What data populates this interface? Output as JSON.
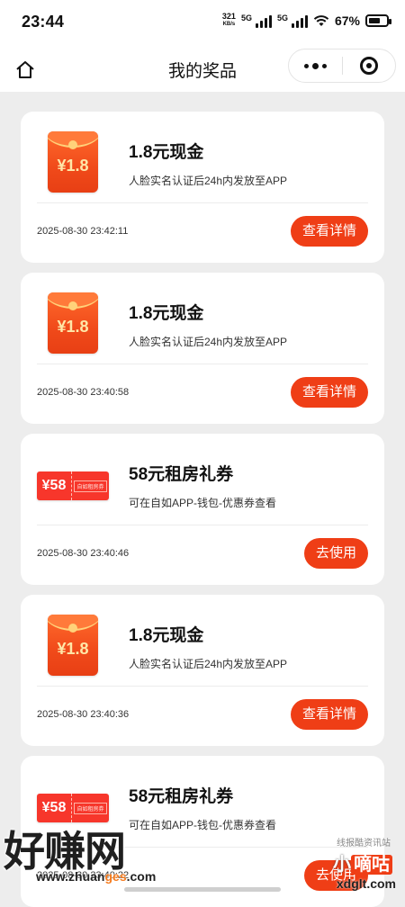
{
  "status_bar": {
    "time": "23:44",
    "net_speed_value": "321",
    "net_speed_unit": "KB/s",
    "sim1_label": "5G",
    "sim2_label": "5G",
    "battery_percent": "67%",
    "battery_level": 0.67
  },
  "nav": {
    "title": "我的奖品",
    "home_icon": "home-icon",
    "more_icon": "more-dots-icon",
    "close_icon": "target-close-icon"
  },
  "prizes": [
    {
      "type": "red-envelope",
      "thumb_amount": "¥1.8",
      "title": "1.8元现金",
      "desc": "人脸实名认证后24h内发放至APP",
      "time": "2025-08-30 23:42:11",
      "action": "查看详情"
    },
    {
      "type": "red-envelope",
      "thumb_amount": "¥1.8",
      "title": "1.8元现金",
      "desc": "人脸实名认证后24h内发放至APP",
      "time": "2025-08-30 23:40:58",
      "action": "查看详情"
    },
    {
      "type": "coupon",
      "thumb_amount": "¥58",
      "thumb_tag": "自如租房券",
      "title": "58元租房礼券",
      "desc": "可在自如APP-钱包-优惠券查看",
      "time": "2025-08-30 23:40:46",
      "action": "去使用"
    },
    {
      "type": "red-envelope",
      "thumb_amount": "¥1.8",
      "title": "1.8元现金",
      "desc": "人脸实名认证后24h内发放至APP",
      "time": "2025-08-30 23:40:36",
      "action": "查看详情"
    },
    {
      "type": "coupon",
      "thumb_amount": "¥58",
      "thumb_tag": "自如租房券",
      "title": "58元租房礼券",
      "desc": "可在自如APP-钱包-优惠券查看",
      "time": "2025-08-30 23:40:22",
      "action": "去使用"
    }
  ],
  "watermark": {
    "left_big": "好赚网",
    "left_url_a": "www.zhuan",
    "left_url_b": "ges",
    "left_url_c": ".com",
    "right_top": "线报酷资讯站",
    "right_mid_a": "小",
    "right_mid_b": "嘀咕",
    "right_bot": "xdglt.com"
  },
  "colors": {
    "accent": "#ef3e16",
    "background": "#ededed",
    "card": "#ffffff"
  }
}
